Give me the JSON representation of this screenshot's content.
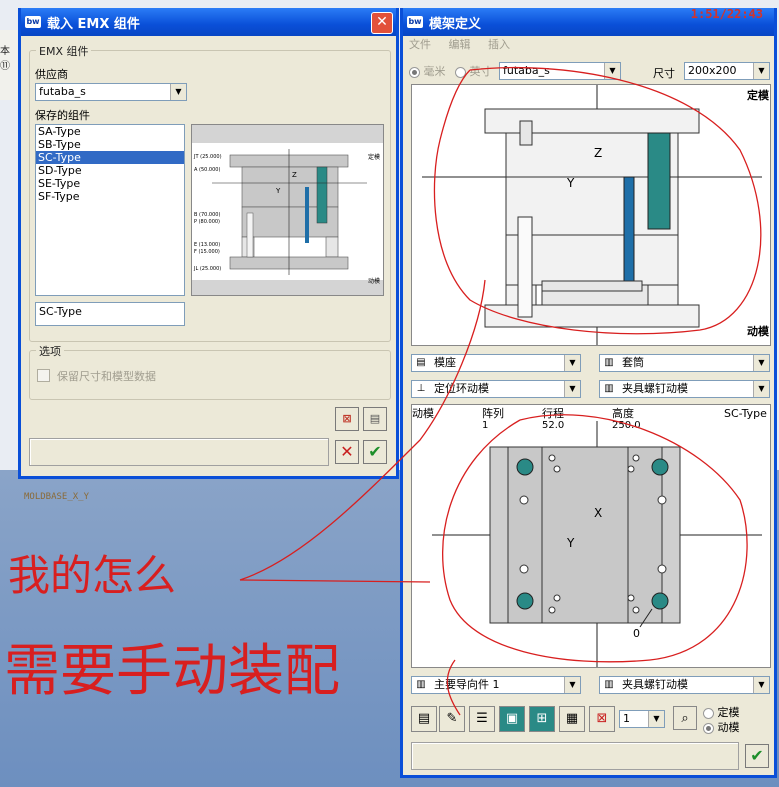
{
  "clock": "1:51/22:43",
  "background": {
    "strip_text": "本 ⑪",
    "moldbase_label": "MOLDBASE_X_Y"
  },
  "dialog_left": {
    "title": "载入 EMX 组件",
    "group_title": "EMX 组件",
    "supplier_label": "供应商",
    "supplier_value": "futaba_s",
    "saved_label": "保存的组件",
    "items": [
      "SA-Type",
      "SB-Type",
      "SC-Type",
      "SD-Type",
      "SE-Type",
      "SF-Type"
    ],
    "selected_index": 2,
    "name_value": "SC-Type",
    "options_title": "选项",
    "checkbox_label": "保留尺寸和模型数据",
    "preview_labels": {
      "top_right": "定模",
      "bottom_right": "动模",
      "jt": "JT (25.000)",
      "a": "A (50.000)",
      "b": "B (70.000)",
      "p": "P (80.000)",
      "e": "E (13.000)",
      "f": "F (15.000)",
      "jl": "JL (25.000)",
      "z": "Z",
      "y": "Y"
    }
  },
  "dialog_right": {
    "title": "模架定义",
    "menu": [
      "文件",
      "编辑",
      "插入"
    ],
    "unit_mm": "毫米",
    "unit_inch": "英寸",
    "supplier_value": "futaba_s",
    "size_label": "尺寸",
    "size_value": "200x200",
    "side_labels": {
      "top": "定模",
      "bottom": "动模"
    },
    "axis_labels": {
      "z": "Z",
      "y": "Y",
      "x": "X"
    },
    "drop_base": "模座",
    "drop_sleeve": "套筒",
    "drop_locate": "定位环动模",
    "drop_clamp1": "夹具螺钉动模",
    "table_headers": [
      "动模",
      "阵列",
      "行程",
      "高度"
    ],
    "table_values": [
      "1",
      "52.0",
      "250.0"
    ],
    "type_label": "SC-Type",
    "zero_label": "0",
    "drop_guide": "主要导向件 1",
    "drop_clamp2": "夹具螺钉动模",
    "count_value": "1",
    "radio_fixed": "定模",
    "radio_moving": "动模"
  },
  "colors": {
    "title_blue": "#0a4fd8",
    "plate_gray": "#c8c8c8",
    "teal": "#2a8a86",
    "pin_blue": "#1f6fa8",
    "annotation_red": "#d81f1f"
  },
  "handwriting": [
    "我的怎么",
    "需要手动装配"
  ]
}
